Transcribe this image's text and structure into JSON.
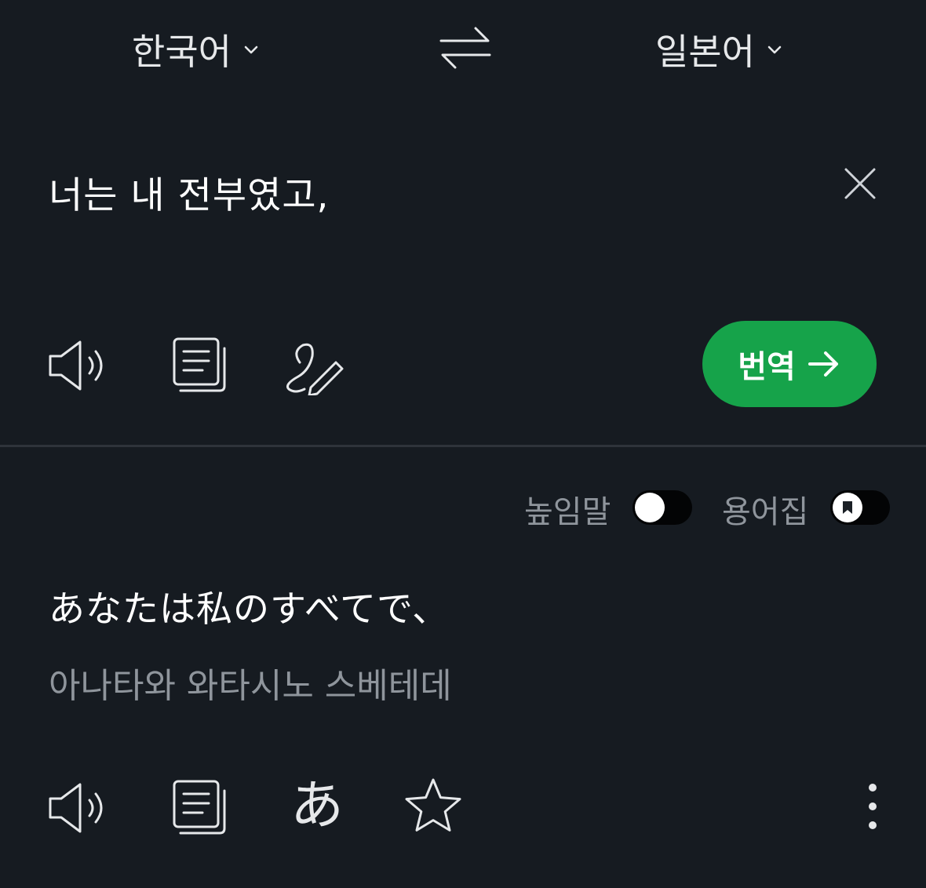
{
  "languages": {
    "source": "한국어",
    "target": "일본어"
  },
  "icons": {
    "swap": "swap-arrows-icon",
    "clear": "close-icon",
    "speaker": "speaker-icon",
    "copy": "copy-icon",
    "handwriting": "handwriting-icon",
    "arrow": "arrow-right-icon",
    "kana": "あ",
    "star": "star-icon",
    "more": "more-vertical-icon",
    "bookmark": "bookmark-icon"
  },
  "source": {
    "text": "너는 내 전부였고,"
  },
  "translate_button": {
    "label": "번역"
  },
  "options": {
    "honorific_label": "높임말",
    "honorific_on": false,
    "glossary_label": "용어집",
    "glossary_on": false
  },
  "result": {
    "text": "あなたは私のすべてで、",
    "pronunciation": "아나타와 와타시노 스베테데"
  },
  "colors": {
    "background": "#161b21",
    "accent": "#16a34a",
    "muted_text": "#8f959c"
  }
}
